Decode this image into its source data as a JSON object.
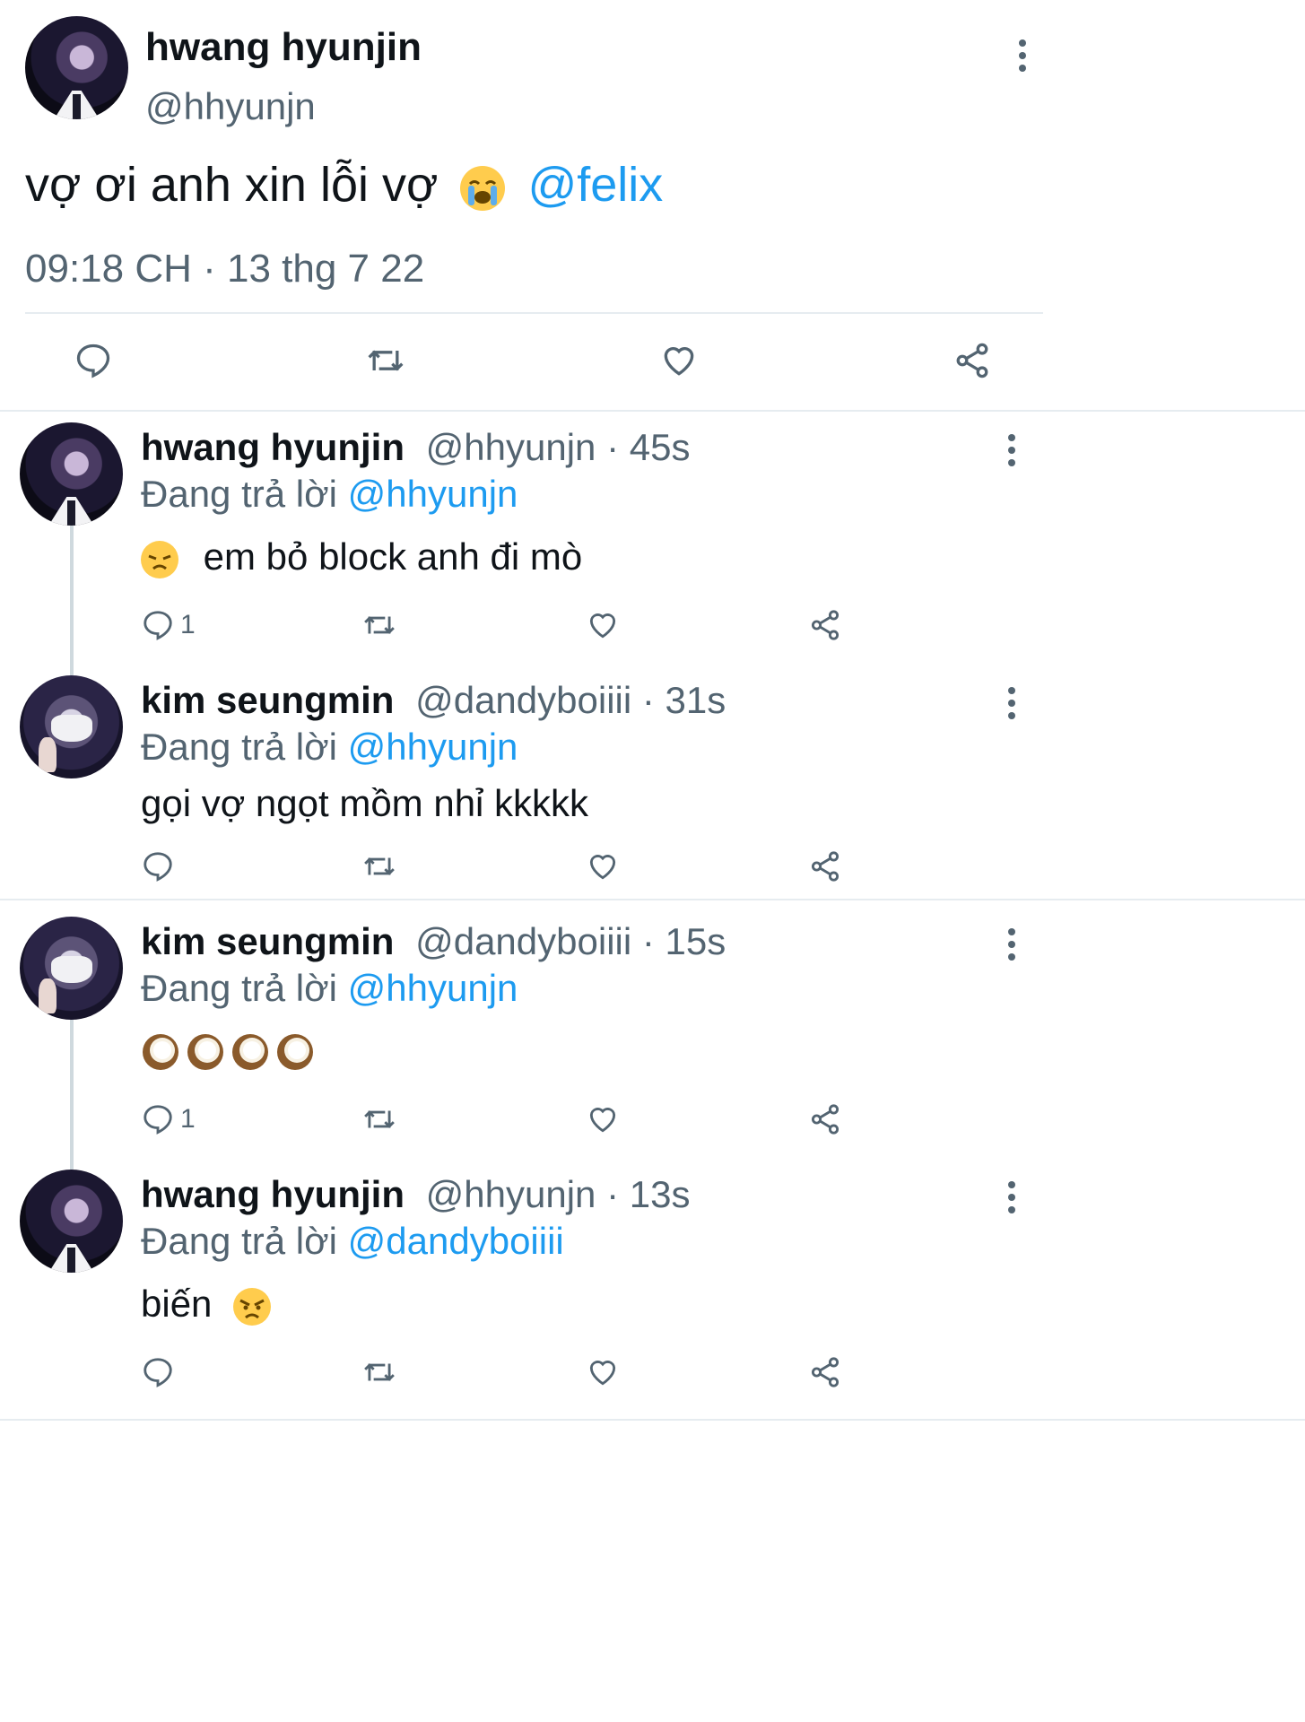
{
  "main_tweet": {
    "author_name": "hwang hyunjin",
    "handle": "@hhyunjn",
    "text": "vợ ơi anh xin lỗi vợ",
    "mention": "@felix",
    "timestamp": "09:18 CH · 13 thg 7 22",
    "emoji": "loudly-crying-face"
  },
  "reply_prefix": "Đang trả lời",
  "replies": [
    {
      "author_name": "hwang hyunjin",
      "meta": "@hhyunjn · 45s",
      "reply_to": "@hhyunjn",
      "text": "em bỏ block anh đi mò",
      "emoji": "disappointed-face",
      "reply_count": "1"
    },
    {
      "author_name": "kim seungmin",
      "meta": "@dandyboiiii · 31s",
      "reply_to": "@hhyunjn",
      "text": "gọi vợ ngọt mồm nhỉ kkkkk",
      "reply_count": ""
    },
    {
      "author_name": "kim seungmin",
      "meta": "@dandyboiiii · 15s",
      "reply_to": "@hhyunjn",
      "text": "",
      "emoji": "coconut x4",
      "reply_count": "1"
    },
    {
      "author_name": "hwang hyunjin",
      "meta": "@hhyunjn · 13s",
      "reply_to": "@dandyboiiii",
      "text": "biến",
      "emoji": "angry-face",
      "reply_count": ""
    }
  ],
  "colors": {
    "link": "#1d9bf0",
    "secondary_text": "#536471",
    "divider": "#e6ecf0"
  }
}
